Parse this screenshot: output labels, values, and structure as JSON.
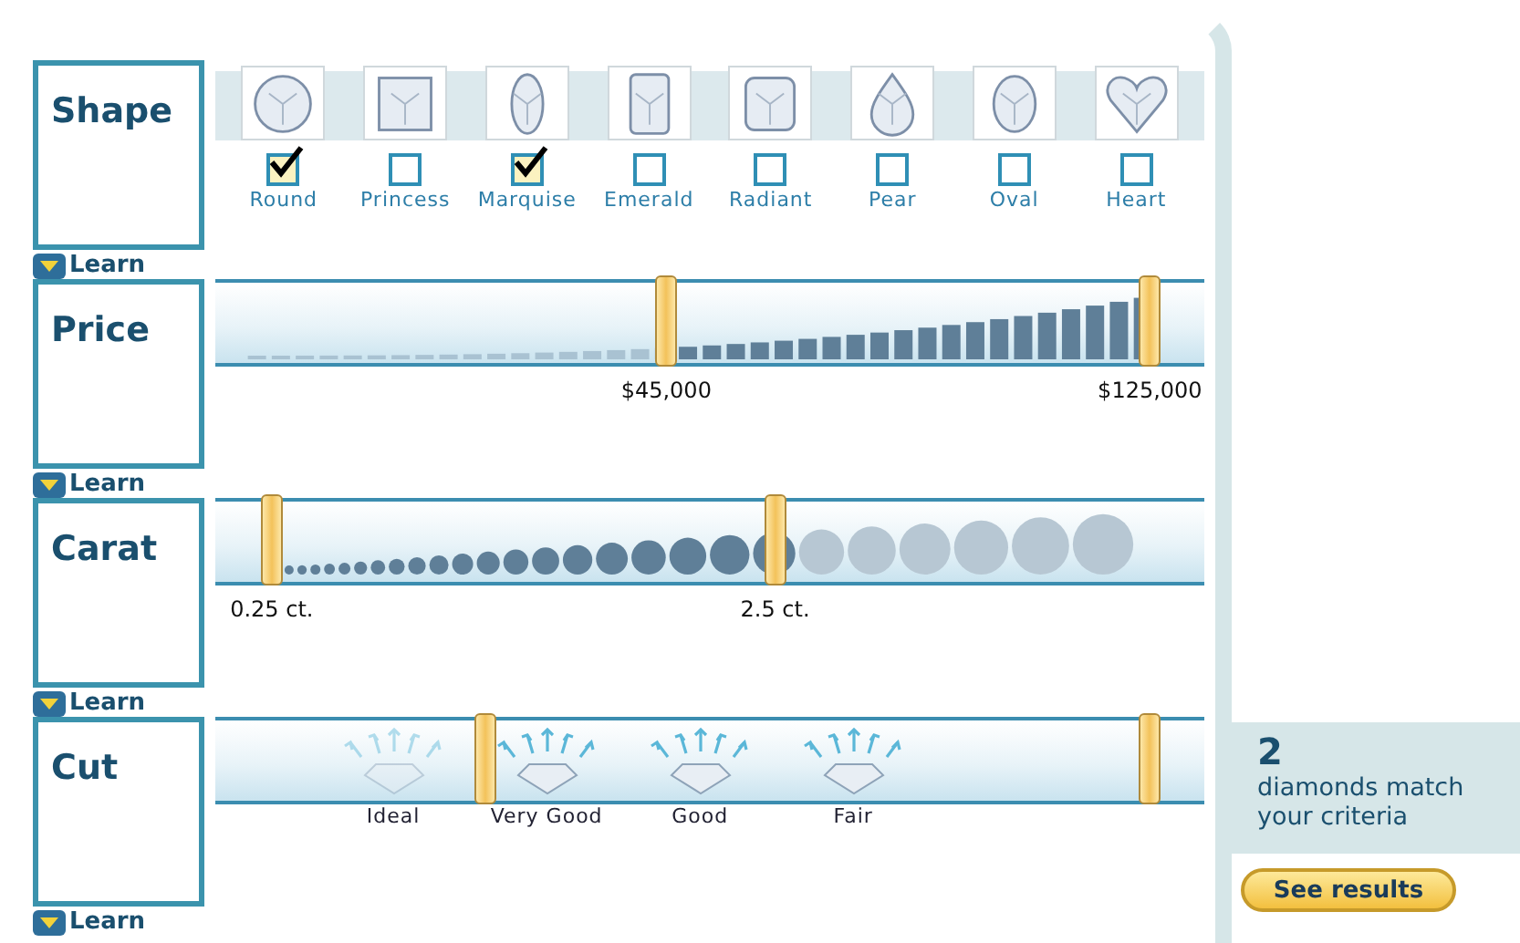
{
  "filters": [
    {
      "kind": "shape",
      "label": "Learn",
      "title": "Shape",
      "shapes": [
        {
          "name": "Round",
          "checked": true
        },
        {
          "name": "Princess",
          "checked": false
        },
        {
          "name": "Marquise",
          "checked": true
        },
        {
          "name": "Emerald",
          "checked": false
        },
        {
          "name": "Radiant",
          "checked": false
        },
        {
          "name": "Pear",
          "checked": false
        },
        {
          "name": "Oval",
          "checked": false
        },
        {
          "name": "Heart",
          "checked": false
        }
      ]
    },
    {
      "kind": "price",
      "label": "Learn",
      "title": "Price",
      "handles": [
        {
          "level": 0.456,
          "reading": "$45,000"
        },
        {
          "level": 0.945,
          "reading": "$125,000"
        }
      ]
    },
    {
      "kind": "carat",
      "label": "Learn",
      "title": "Carat",
      "handles": [
        {
          "level": 0.057,
          "reading": "0.25 ct."
        },
        {
          "level": 0.566,
          "reading": "2.5 ct."
        }
      ]
    },
    {
      "kind": "cut",
      "label": "Learn",
      "title": "Cut",
      "handles": [
        {
          "level": 0.273
        },
        {
          "level": 0.945
        }
      ],
      "grades": [
        "Ideal",
        "Very Good",
        "Good",
        "Fair"
      ]
    }
  ],
  "results": {
    "count": "2",
    "text": "diamonds match your criteria",
    "button": "See results"
  }
}
